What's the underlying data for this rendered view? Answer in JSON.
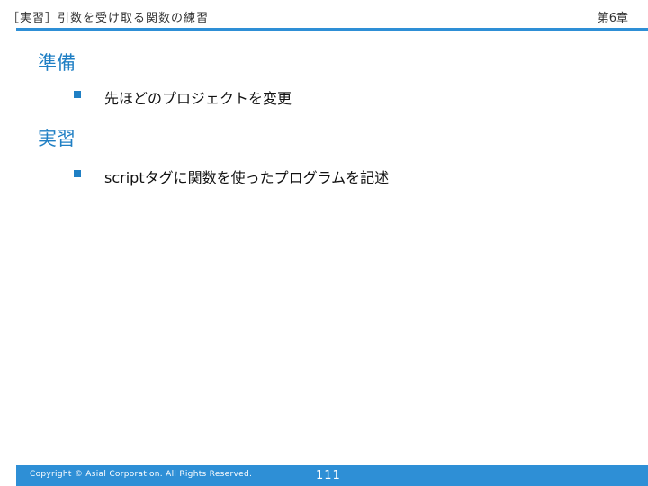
{
  "header": {
    "title": "［実習］引数を受け取る関数の練習",
    "chapter": "第6章"
  },
  "sections": [
    {
      "heading": "準備",
      "bullets": [
        "先ほどのプロジェクトを変更"
      ]
    },
    {
      "heading": "実習",
      "bullets": [
        "scriptタグに関数を使ったプログラムを記述"
      ]
    }
  ],
  "footer": {
    "copyright": "Copyright © Asial Corporation. All Rights Reserved.",
    "page_number": "111"
  },
  "colors": {
    "accent": "#2e8fd6",
    "heading": "#1f7fc4"
  }
}
